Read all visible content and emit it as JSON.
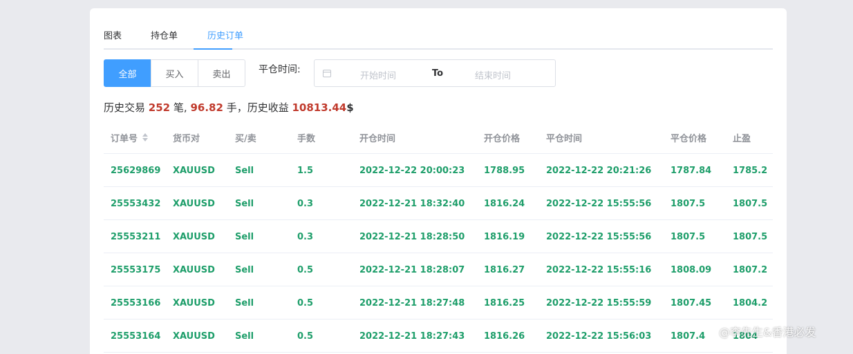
{
  "tabs": [
    {
      "label": "图表"
    },
    {
      "label": "持仓单"
    },
    {
      "label": "历史订单"
    }
  ],
  "active_tab": "历史订单",
  "filter": {
    "segments": [
      {
        "label": "全部"
      },
      {
        "label": "买入"
      },
      {
        "label": "卖出"
      }
    ],
    "active_segment": "全部",
    "close_time_label": "平仓时间:",
    "start_placeholder": "开始时间",
    "to_label": "To",
    "end_placeholder": "结束时间"
  },
  "summary": {
    "prefix": "历史交易",
    "trades": "252",
    "trades_unit": "笔,",
    "lots": "96.82",
    "lots_unit": "手，历史收益",
    "profit": "10813.44",
    "currency": "$"
  },
  "table": {
    "columns": [
      "订单号",
      "货币对",
      "买/卖",
      "手数",
      "开仓时间",
      "开仓价格",
      "平仓时间",
      "平仓价格",
      "止盈"
    ],
    "rows": [
      [
        "25629869",
        "XAUUSD",
        "Sell",
        "1.5",
        "2022-12-22 20:00:23",
        "1788.95",
        "2022-12-22 20:21:26",
        "1787.84",
        "1785.2"
      ],
      [
        "25553432",
        "XAUUSD",
        "Sell",
        "0.3",
        "2022-12-21 18:32:40",
        "1816.24",
        "2022-12-22 15:55:56",
        "1807.5",
        "1807.5"
      ],
      [
        "25553211",
        "XAUUSD",
        "Sell",
        "0.3",
        "2022-12-21 18:28:50",
        "1816.19",
        "2022-12-22 15:55:56",
        "1807.5",
        "1807.5"
      ],
      [
        "25553175",
        "XAUUSD",
        "Sell",
        "0.5",
        "2022-12-21 18:28:07",
        "1816.27",
        "2022-12-22 15:55:16",
        "1808.09",
        "1807.2"
      ],
      [
        "25553166",
        "XAUUSD",
        "Sell",
        "0.5",
        "2022-12-21 18:27:48",
        "1816.25",
        "2022-12-22 15:55:59",
        "1807.45",
        "1804.2"
      ],
      [
        "25553164",
        "XAUUSD",
        "Sell",
        "0.5",
        "2022-12-21 18:27:43",
        "1816.26",
        "2022-12-22 15:56:03",
        "1807.4",
        "1804"
      ]
    ]
  },
  "watermark": "@李先生&香港必发",
  "colors": {
    "accent": "#409eff",
    "profit_text": "#1e9e6a",
    "summary_number": "#c0392b"
  }
}
